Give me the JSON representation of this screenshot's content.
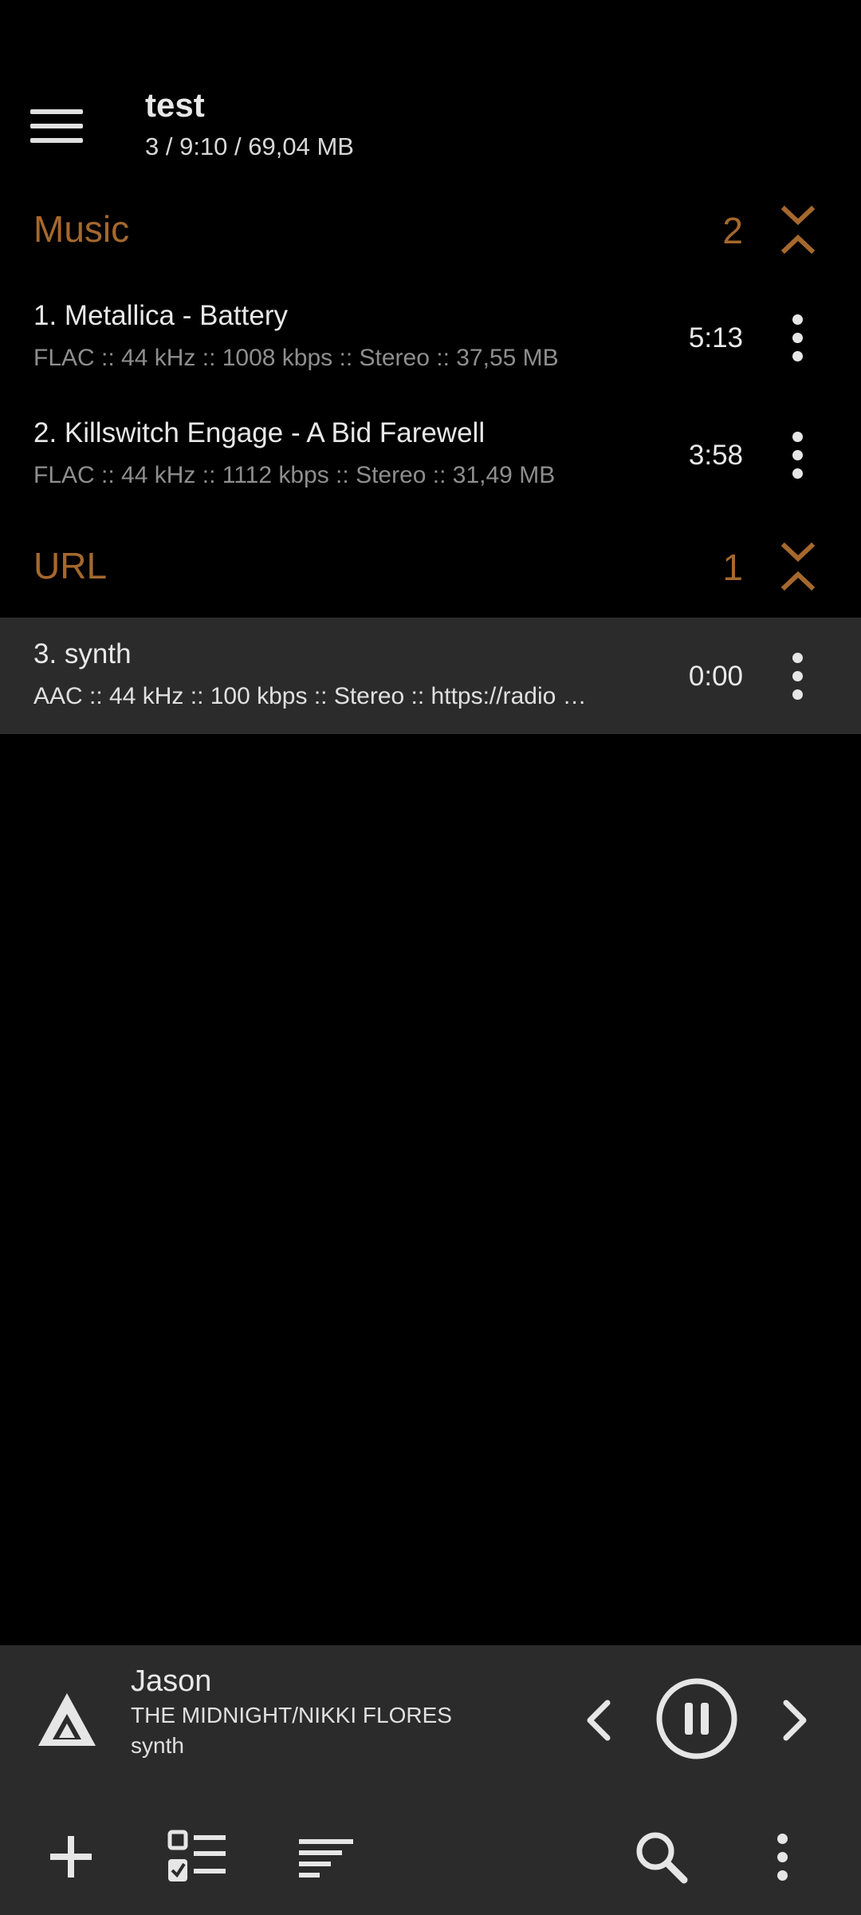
{
  "header": {
    "title": "test",
    "subtitle": "3 / 9:10 / 69,04 MB"
  },
  "groups": [
    {
      "name": "Music",
      "count": "2"
    },
    {
      "name": "URL",
      "count": "1"
    }
  ],
  "tracks": [
    {
      "title": "1. Metallica - Battery",
      "meta": "FLAC :: 44 kHz :: 1008 kbps :: Stereo :: 37,55 MB",
      "duration": "5:13"
    },
    {
      "title": "2. Killswitch Engage - A Bid Farewell",
      "meta": "FLAC :: 44 kHz :: 1112 kbps :: Stereo :: 31,49 MB",
      "duration": "3:58"
    },
    {
      "title": "3. synth",
      "meta": "AAC :: 44 kHz :: 100 kbps :: Stereo :: https://radio …",
      "duration": "0:00"
    }
  ],
  "player": {
    "title": "Jason",
    "artist": "THE MIDNIGHT/NIKKI FLORES",
    "album": "synth"
  },
  "icons": {
    "menu": "menu-icon",
    "collapse": "collapse-expand-icon",
    "more": "more-vertical-icon",
    "logo": "aimp-logo-icon",
    "prev": "chevron-left-icon",
    "pause": "pause-icon",
    "next": "chevron-right-icon",
    "add": "plus-icon",
    "select": "checklist-icon",
    "sort": "sort-icon",
    "search": "search-icon"
  },
  "colors": {
    "accent": "#a5682d",
    "background": "#000000",
    "panel": "#2b2b2b"
  }
}
